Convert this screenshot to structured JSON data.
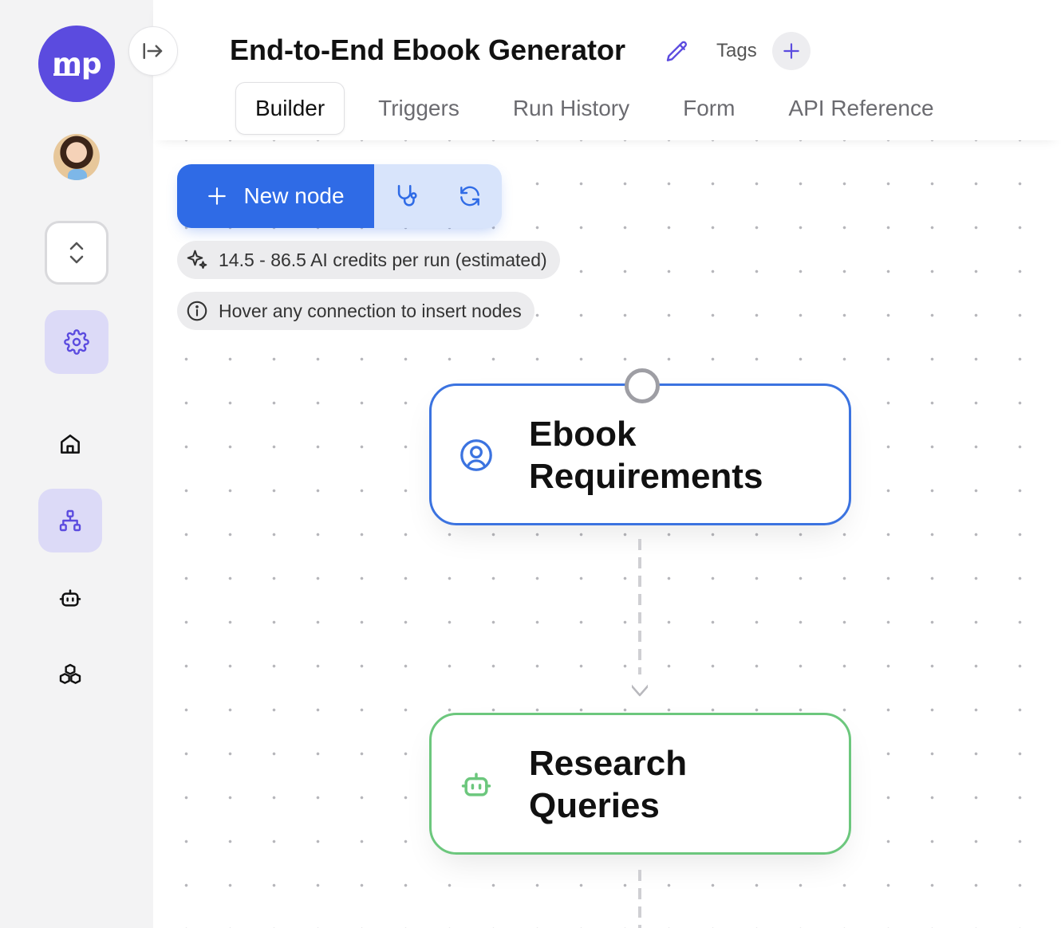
{
  "app": {
    "logo_text": "mp",
    "brand_color": "#5b4bdf",
    "accent_color": "#2f6be6"
  },
  "sidebar": {
    "collapse_icon": "expand-sidebar-icon",
    "switcher_icon": "chevron-up-down-icon",
    "settings_icon": "gear-icon",
    "items": [
      {
        "name": "home",
        "icon": "home-icon",
        "active": false
      },
      {
        "name": "workflows",
        "icon": "workflow-icon",
        "active": true
      },
      {
        "name": "agents",
        "icon": "bot-icon",
        "active": false
      },
      {
        "name": "integrations",
        "icon": "boxes-icon",
        "active": false
      }
    ]
  },
  "header": {
    "title": "End-to-End Ebook Generator",
    "tags_label": "Tags",
    "tabs": [
      {
        "label": "Builder",
        "active": true
      },
      {
        "label": "Triggers",
        "active": false
      },
      {
        "label": "Run History",
        "active": false
      },
      {
        "label": "Form",
        "active": false
      },
      {
        "label": "API Reference",
        "active": false
      }
    ]
  },
  "canvas": {
    "new_node_label": "New node",
    "credits_info": "14.5 - 86.5 AI credits per run (estimated)",
    "hover_hint": "Hover any connection to insert nodes",
    "nodes": [
      {
        "title": "Ebook Requirements",
        "icon": "user-circle-icon",
        "color": "#3b73e0"
      },
      {
        "title": "Research Queries",
        "icon": "bot-icon",
        "color": "#6cc77d"
      }
    ]
  }
}
